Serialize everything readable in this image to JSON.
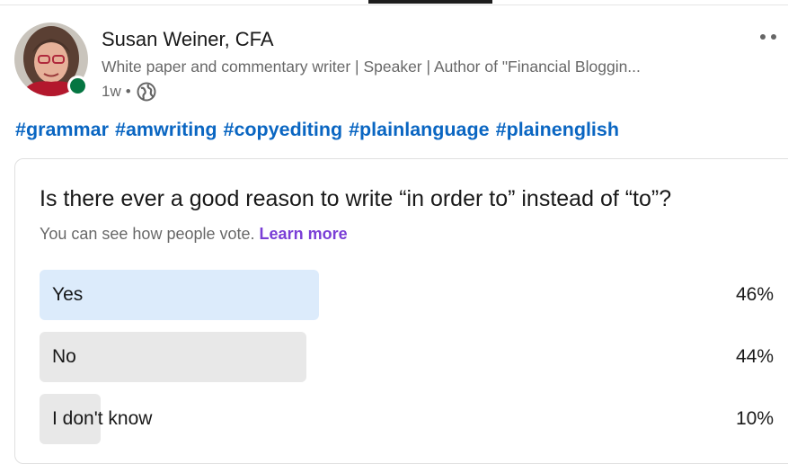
{
  "colors": {
    "link": "#0a66c2",
    "purple": "#7a3ed6",
    "presence_green": "#057642",
    "selected_fill": "#dcebfb",
    "result_fill": "#e8e8e8"
  },
  "post": {
    "author": {
      "name": "Susan Weiner, CFA",
      "headline": "White paper and commentary writer | Speaker | Author of \"Financial Bloggin...",
      "time": "1w",
      "separator": "•",
      "visibility_icon": "globe-icon",
      "online": true
    },
    "hashtags": [
      "#grammar",
      "#amwriting",
      "#copyediting",
      "#plainlanguage",
      "#plainenglish"
    ],
    "more_menu_icon": "more-dots-icon"
  },
  "poll": {
    "question": "Is there ever a good reason to write “in order to” instead of “to”?",
    "visibility_note": "You can see how people vote.",
    "learn_more": "Learn more",
    "options": [
      {
        "label": "Yes",
        "percent_text": "46%",
        "share": 0.46,
        "selected": true
      },
      {
        "label": "No",
        "percent_text": "44%",
        "share": 0.44,
        "selected": false
      },
      {
        "label": "I don't know",
        "percent_text": "10%",
        "share": 0.1,
        "selected": false
      }
    ]
  }
}
